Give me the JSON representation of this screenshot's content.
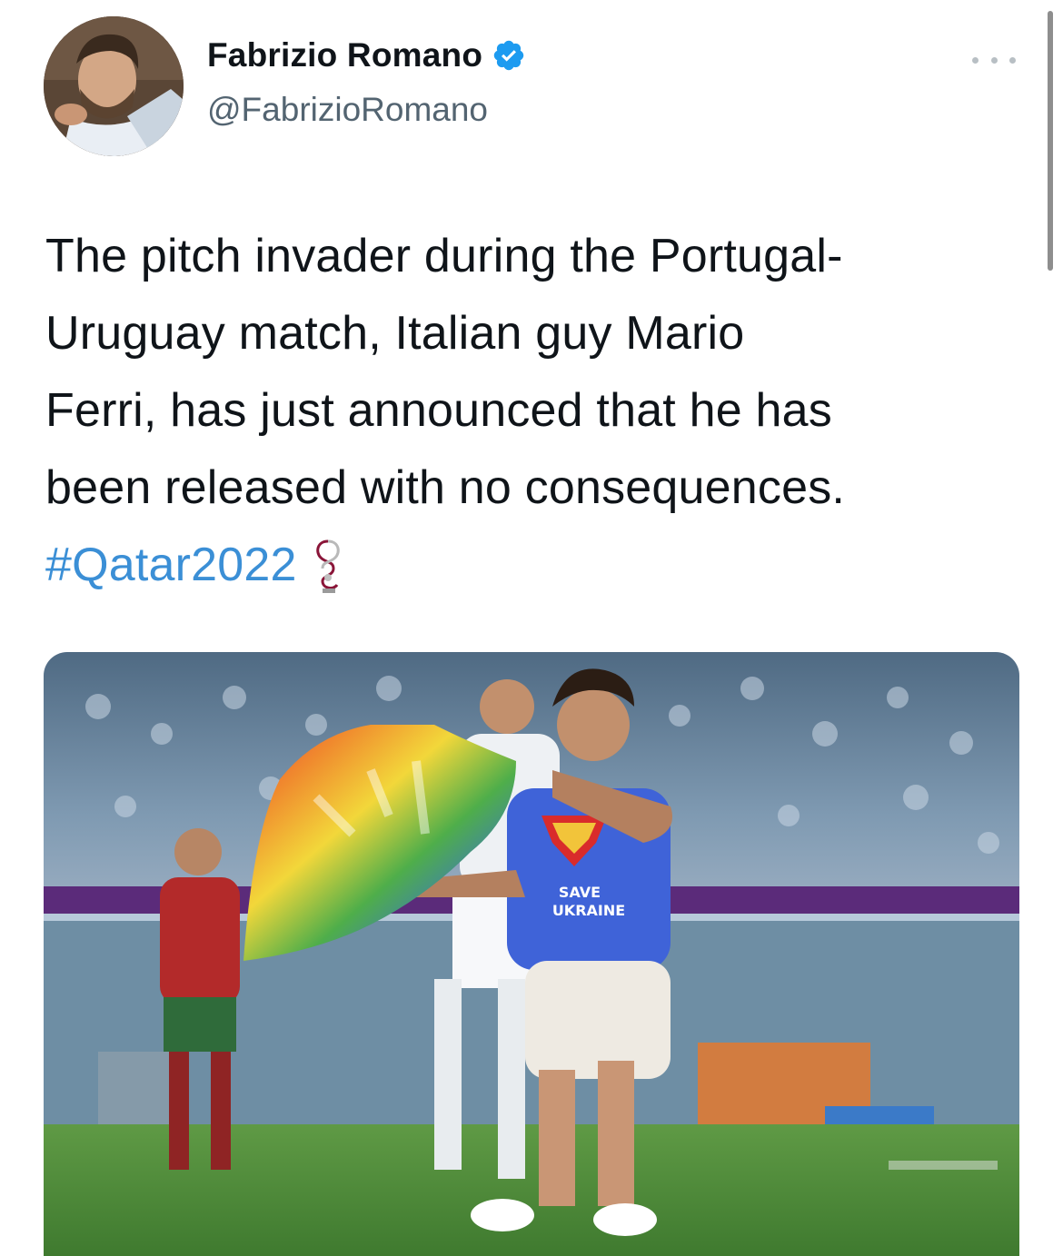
{
  "tweet": {
    "author": {
      "display_name": "Fabrizio Romano",
      "handle": "@FabrizioRomano",
      "verified": true
    },
    "text_lines": [
      "The pitch invader during the Portugal-",
      "Uruguay match, Italian guy Mario",
      "Ferri, has just announced that he has",
      "been released with no consequences."
    ],
    "hashtag": "#Qatar2022",
    "media": {
      "shirt_text_line1": "SAVE",
      "shirt_text_line2": "UKRAINE"
    }
  },
  "colors": {
    "accent": "#3b8fd6",
    "verified_badge": "#1d9bf0",
    "secondary_text": "#536471",
    "pitch_green": "#4f8a3a",
    "shirt_blue": "#3f63d8"
  },
  "icons": [
    "verified-badge-icon",
    "more-options-icon",
    "world-cup-trophy-icon"
  ]
}
